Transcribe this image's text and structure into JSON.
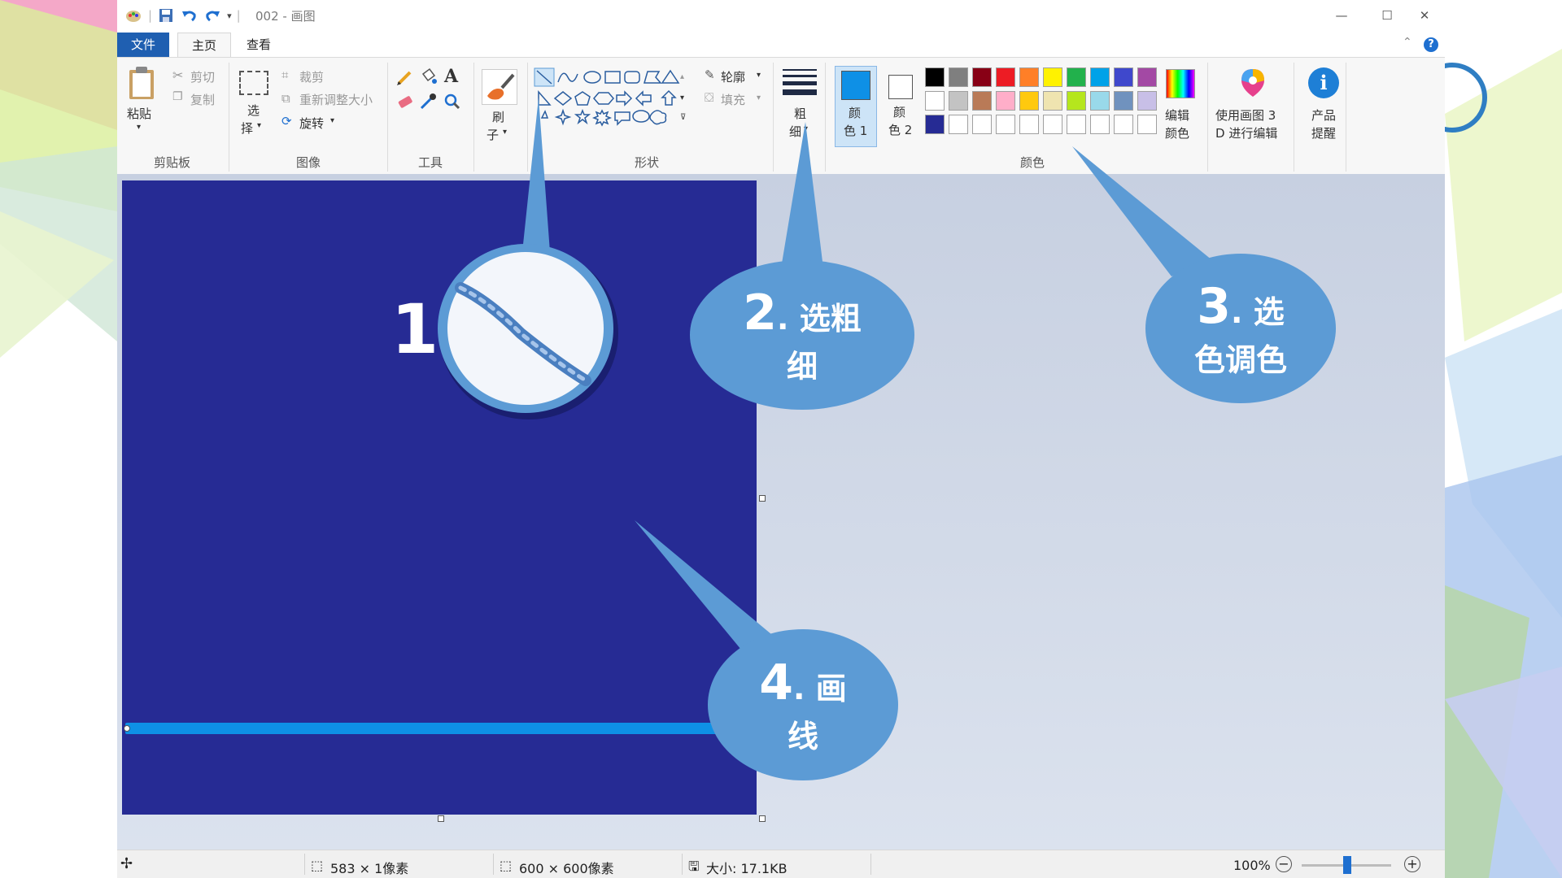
{
  "window": {
    "title": "002 - 画图",
    "minimize_glyph": "—",
    "maximize_glyph": "☐",
    "close_glyph": "✕"
  },
  "tabs": [
    {
      "label": "文件"
    },
    {
      "label": "主页"
    },
    {
      "label": "查看"
    }
  ],
  "clipboard": {
    "paste": "粘贴",
    "cut": "剪切",
    "copy": "复制",
    "label": "剪贴板"
  },
  "image": {
    "select_top": "选",
    "select_bottom": "择",
    "crop": "裁剪",
    "resize": "重新调整大小",
    "rotate": "旋转",
    "label": "图像"
  },
  "tools": {
    "label": "工具",
    "text_glyph": "A"
  },
  "brush": {
    "top": "刷",
    "bottom": "子"
  },
  "shapes": {
    "outline": "轮廓",
    "fill": "填充",
    "label": "形状"
  },
  "size": {
    "top": "粗",
    "bottom": "细"
  },
  "color1": {
    "top": "颜",
    "bottom": "色 1",
    "value": "#0e90e6"
  },
  "color2": {
    "top": "颜",
    "bottom": "色 2",
    "value": "#ffffff"
  },
  "colors": {
    "label": "颜色",
    "edit_top": "编辑",
    "edit_bottom": "颜色",
    "palette_row1": [
      "#000000",
      "#7f7f7f",
      "#880015",
      "#ed1c24",
      "#ff7f27",
      "#fff200",
      "#22b14c",
      "#00a2e8",
      "#3f48cc",
      "#a349a4"
    ],
    "palette_row2": [
      "#ffffff",
      "#c3c3c3",
      "#b97a57",
      "#ffaec9",
      "#ffc90e",
      "#efe4b0",
      "#b5e61d",
      "#99d9ea",
      "#7092be",
      "#c8bfe7"
    ],
    "palette_row3": [
      "#262b94",
      "#ffffff",
      "#ffffff",
      "#ffffff",
      "#ffffff",
      "#ffffff",
      "#ffffff",
      "#ffffff",
      "#ffffff",
      "#ffffff"
    ]
  },
  "paint3d": {
    "top": "使用画图 3",
    "bottom": "D 进行编辑"
  },
  "alert": {
    "top": "产品",
    "bottom": "提醒"
  },
  "canvas": {
    "background": "#262b94",
    "line_color": "#0e90e6"
  },
  "callouts": [
    {
      "num": "1",
      "text": ""
    },
    {
      "num": "2",
      "text1": ". 选粗",
      "text2": "细"
    },
    {
      "num": "3",
      "text1": ". 选",
      "text2": "色调色"
    },
    {
      "num": "4",
      "text1": ". 画",
      "text2": "线"
    }
  ],
  "status": {
    "selection": "583 × 1像素",
    "canvas_size": "600 × 600像素",
    "file_size": "大小: 17.1KB",
    "zoom": "100%"
  }
}
